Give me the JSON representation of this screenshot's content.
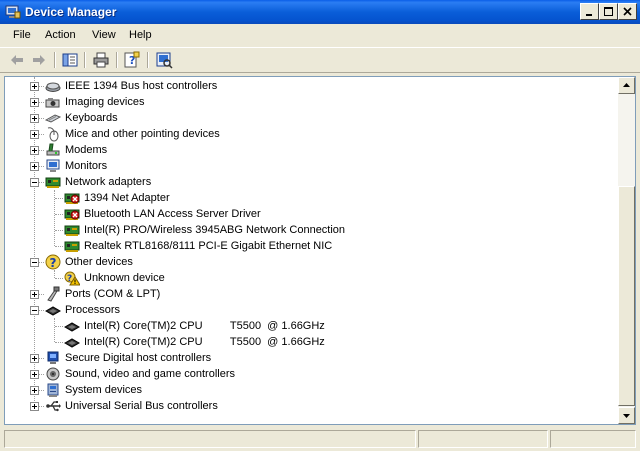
{
  "window": {
    "title": "Device Manager"
  },
  "menu": {
    "file": "File",
    "action": "Action",
    "view": "View",
    "help": "Help"
  },
  "toolbar": {
    "icons": [
      "back-arrow-icon",
      "forward-arrow-icon",
      "show-hide-console-tree-icon",
      "print-icon",
      "help-icon",
      "scan-hardware-icon"
    ]
  },
  "tree": {
    "items": [
      {
        "label": "IEEE 1394 Bus host controllers",
        "icon": "ieee1394-icon",
        "expanded": false
      },
      {
        "label": "Imaging devices",
        "icon": "camera-icon",
        "expanded": false
      },
      {
        "label": "Keyboards",
        "icon": "keyboard-icon",
        "expanded": false
      },
      {
        "label": "Mice and other pointing devices",
        "icon": "mouse-icon",
        "expanded": false
      },
      {
        "label": "Modems",
        "icon": "modem-icon",
        "expanded": false
      },
      {
        "label": "Monitors",
        "icon": "monitor-icon",
        "expanded": false
      },
      {
        "label": "Network adapters",
        "icon": "network-card-icon",
        "expanded": true
      },
      {
        "label": "1394 Net Adapter",
        "icon": "network-card-disabled-icon",
        "child": true
      },
      {
        "label": "Bluetooth LAN Access Server Driver",
        "icon": "network-card-disabled-icon",
        "child": true
      },
      {
        "label": "Intel(R) PRO/Wireless 3945ABG Network Connection",
        "icon": "network-card-icon",
        "child": true
      },
      {
        "label": "Realtek RTL8168/8111 PCI-E Gigabit Ethernet NIC",
        "icon": "network-card-icon",
        "child": true
      },
      {
        "label": "Other devices",
        "icon": "question-mark-icon",
        "expanded": true
      },
      {
        "label": "Unknown device",
        "icon": "unknown-device-warning-icon",
        "child": true
      },
      {
        "label": "Ports (COM & LPT)",
        "icon": "port-icon",
        "expanded": false
      },
      {
        "label": "Processors",
        "icon": "processor-icon",
        "expanded": true
      },
      {
        "label": "Intel(R) Core(TM)2 CPU         T5500  @ 1.66GHz",
        "icon": "processor-icon",
        "child": true
      },
      {
        "label": "Intel(R) Core(TM)2 CPU         T5500  @ 1.66GHz",
        "icon": "processor-icon",
        "child": true
      },
      {
        "label": "Secure Digital host controllers",
        "icon": "sd-controller-icon",
        "expanded": false
      },
      {
        "label": "Sound, video and game controllers",
        "icon": "speaker-icon",
        "expanded": false
      },
      {
        "label": "System devices",
        "icon": "system-device-icon",
        "expanded": false
      },
      {
        "label": "Universal Serial Bus controllers",
        "icon": "usb-icon",
        "expanded": false
      }
    ]
  },
  "colors": {
    "titlebar": "#0a5ee8",
    "panel": "#ece9d8",
    "treeBorder": "#7f9db9"
  }
}
